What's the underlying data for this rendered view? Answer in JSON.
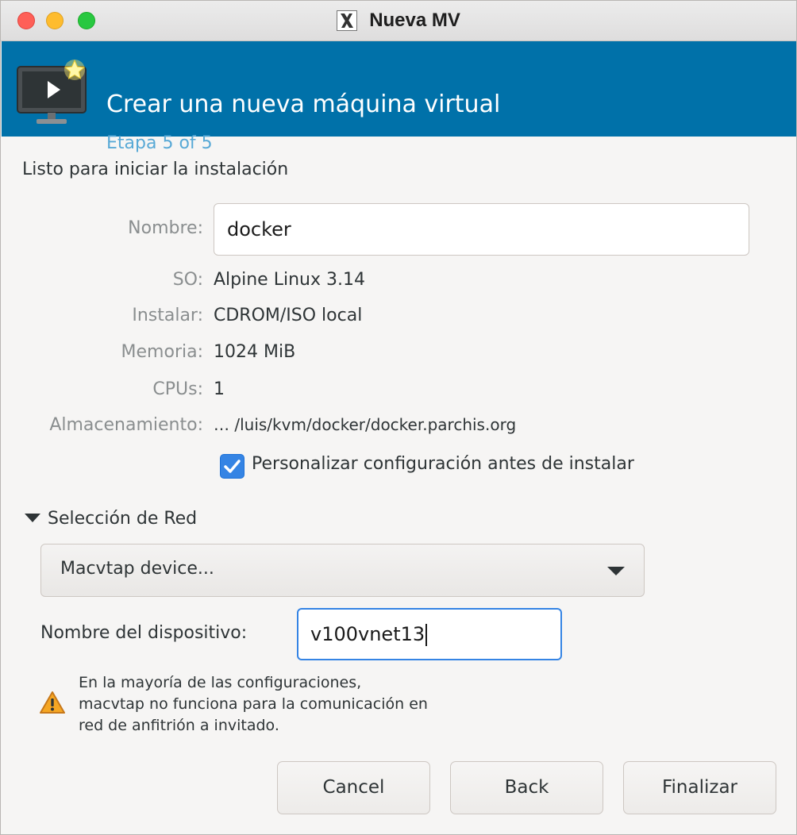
{
  "window": {
    "title": "Nueva MV"
  },
  "banner": {
    "title": "Crear una nueva máquina virtual",
    "step": "Etapa 5 of 5"
  },
  "content": {
    "heading": "Listo para iniciar la instalación",
    "fields": {
      "name_label": "Nombre:",
      "name_value": "docker",
      "os_label": "SO:",
      "os_value": "Alpine Linux 3.14",
      "install_label": "Instalar:",
      "install_value": "CDROM/ISO local",
      "memory_label": "Memoria:",
      "memory_value": "1024 MiB",
      "cpus_label": "CPUs:",
      "cpus_value": "1",
      "storage_label": "Almacenamiento:",
      "storage_value": "… /luis/kvm/docker/docker.parchis.org"
    },
    "customize": {
      "label": "Personalizar configuración antes de instalar",
      "checked": true
    }
  },
  "network": {
    "section_label": "Selección de Red",
    "source_selected": "Macvtap device...",
    "device_label": "Nombre del dispositivo:",
    "device_value": "v100vnet13",
    "warning": "En la mayoría de las configuraciones, macvtap no funciona para la comunicación en red de anfitrión a invitado.",
    "warning_lines": [
      "En la mayoría de las configuraciones,",
      "macvtap no funciona para la comunicación en",
      "red de anfitrión a invitado."
    ]
  },
  "buttons": {
    "cancel": "Cancel",
    "back": "Back",
    "finish": "Finalizar"
  },
  "icons": {
    "window_app": "x11-icon",
    "banner": "vm-monitor-new-icon",
    "checkbox": "checkmark-icon",
    "expander": "triangle-down-icon",
    "combo": "dropdown-arrow-icon",
    "warning": "warning-icon"
  },
  "colors": {
    "banner_bg": "#0071a9",
    "accent": "#3584e4",
    "step_text": "#58a9d6"
  }
}
